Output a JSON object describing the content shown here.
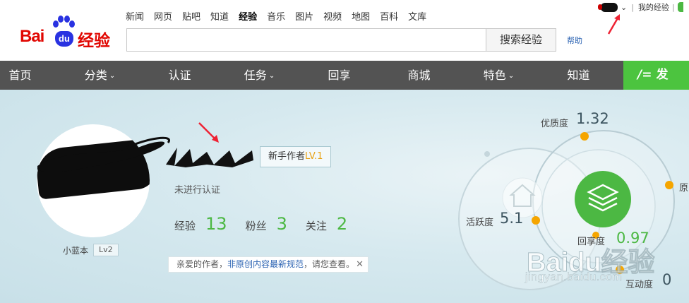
{
  "logo": {
    "bai": "Bai",
    "du": "du",
    "jingyan": "经验"
  },
  "top_nav": [
    "新闻",
    "网页",
    "贴吧",
    "知道",
    "经验",
    "音乐",
    "图片",
    "视频",
    "地图",
    "百科",
    "文库"
  ],
  "top_nav_active": "经验",
  "search": {
    "value": "",
    "button_label": "搜索经验",
    "help_label": "帮助"
  },
  "user_bar": {
    "caret": "⌄",
    "sep": "|",
    "my_experience": "我的经验"
  },
  "main_nav": [
    {
      "label": "首页",
      "dropdown": false
    },
    {
      "label": "分类",
      "dropdown": true
    },
    {
      "label": "认证",
      "dropdown": false
    },
    {
      "label": "任务",
      "dropdown": true
    },
    {
      "label": "回享",
      "dropdown": false
    },
    {
      "label": "商城",
      "dropdown": false
    },
    {
      "label": "特色",
      "dropdown": true
    },
    {
      "label": "知道",
      "dropdown": false
    }
  ],
  "publish": {
    "icon": "pen-icon",
    "label": "发"
  },
  "profile": {
    "newbie_badge": "新手作者",
    "newbie_level": "LV.1",
    "verification": "未进行认证",
    "stats": [
      {
        "label": "经验",
        "value": "13"
      },
      {
        "label": "粉丝",
        "value": "3"
      },
      {
        "label": "关注",
        "value": "2"
      }
    ],
    "nickname": "小蓝本",
    "level": "Lv2"
  },
  "notice": {
    "prefix": "亲爱的作者，",
    "link": "非原创内容最新规范",
    "suffix": "，请您查看。",
    "close": "✕"
  },
  "radar": {
    "quality": {
      "label": "优质度",
      "value": "1.32"
    },
    "activity": {
      "label": "活跃度",
      "value": "5.1"
    },
    "original": {
      "label": "原"
    },
    "help": {
      "label": "回享度",
      "value": "0.97"
    },
    "interaction": {
      "label": "互动度",
      "value": "0"
    }
  },
  "watermark": {
    "brand": "Baidu经验",
    "url": "jingyan.baidu.com"
  },
  "colors": {
    "brand_red": "#e10601",
    "brand_blue": "#2932e1",
    "accent_green": "#4cb843",
    "nav_bg": "#535353",
    "dot_orange": "#f5a500"
  }
}
